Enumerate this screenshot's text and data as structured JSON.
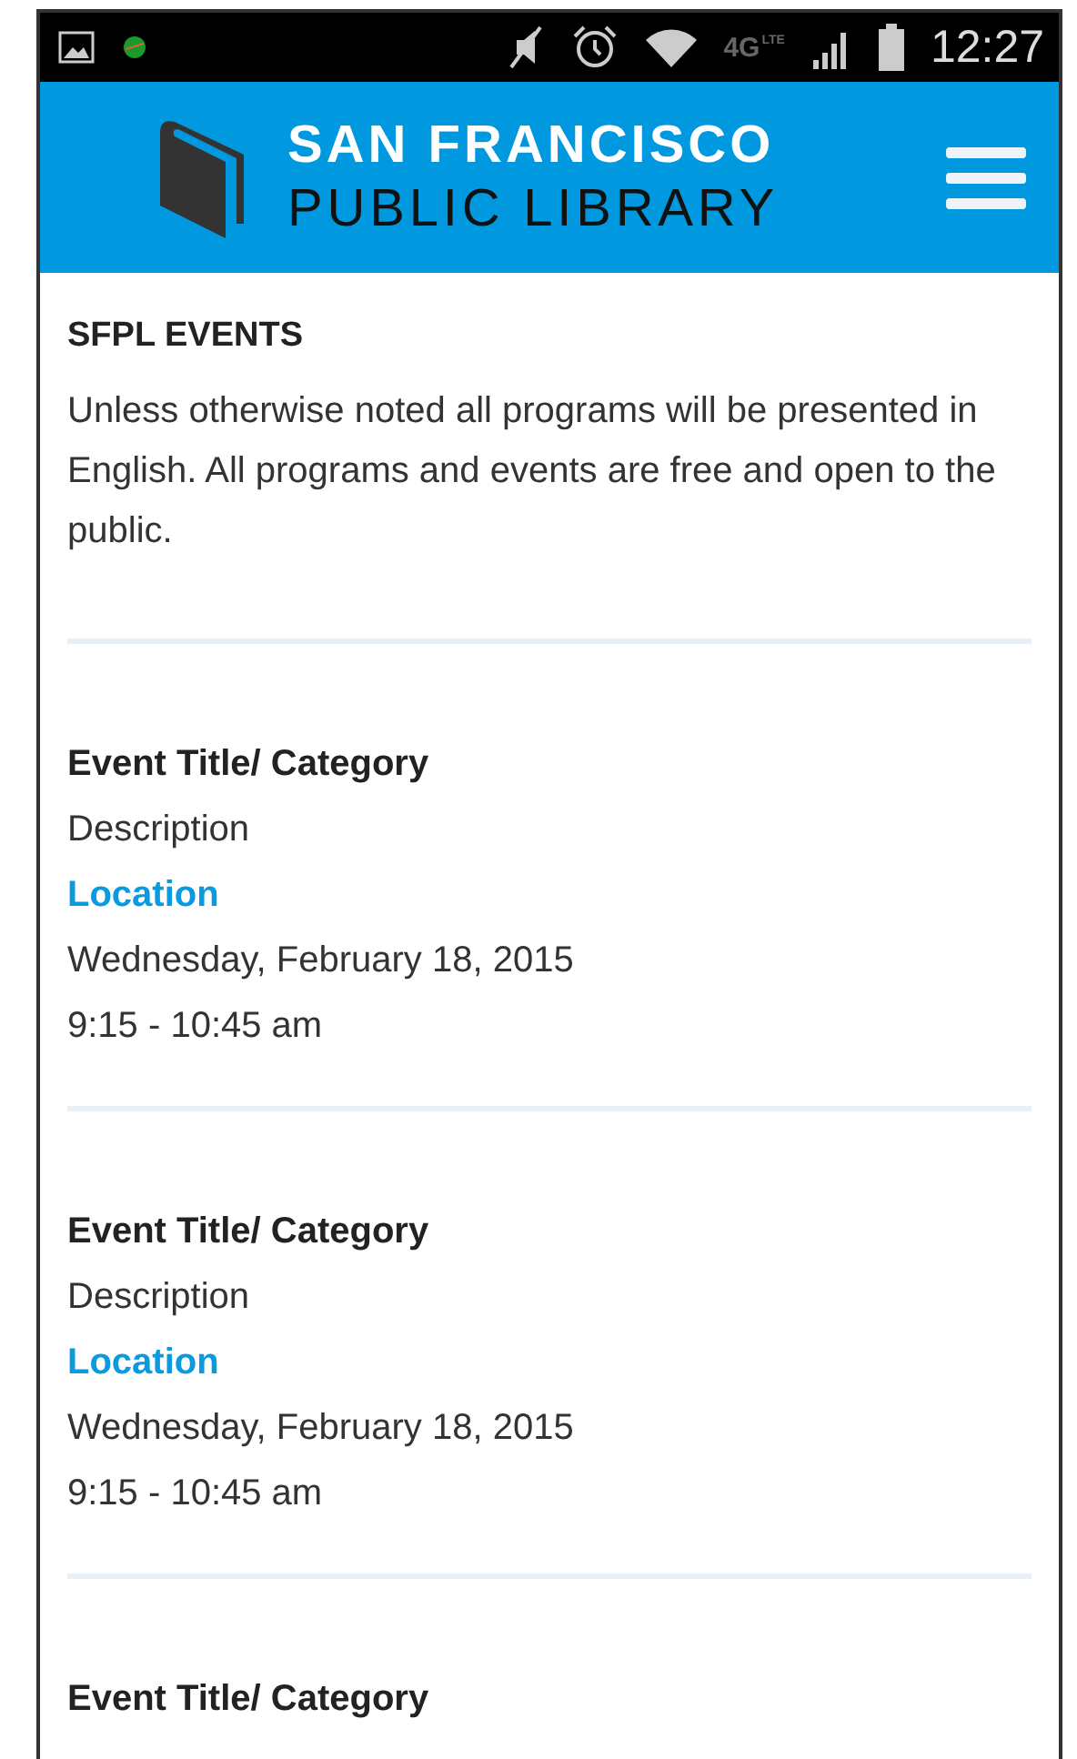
{
  "status_bar": {
    "network": "4G",
    "network_sub": "LTE",
    "time": "12:27"
  },
  "header": {
    "title_line1": "SAN FRANCISCO",
    "title_line2": "PUBLIC LIBRARY"
  },
  "intro": {
    "heading": "SFPL EVENTS",
    "text": "Unless otherwise noted all programs will be presented in English. All programs and events are free and open to the public."
  },
  "events": [
    {
      "title": "Event Title/ Category",
      "description": "Description",
      "location": "Location",
      "date": "Wednesday, February 18, 2015",
      "time": "9:15 - 10:45 am"
    },
    {
      "title": "Event Title/ Category",
      "description": "Description",
      "location": "Location",
      "date": "Wednesday, February 18, 2015",
      "time": "9:15 - 10:45 am"
    },
    {
      "title": "Event Title/ Category"
    }
  ]
}
